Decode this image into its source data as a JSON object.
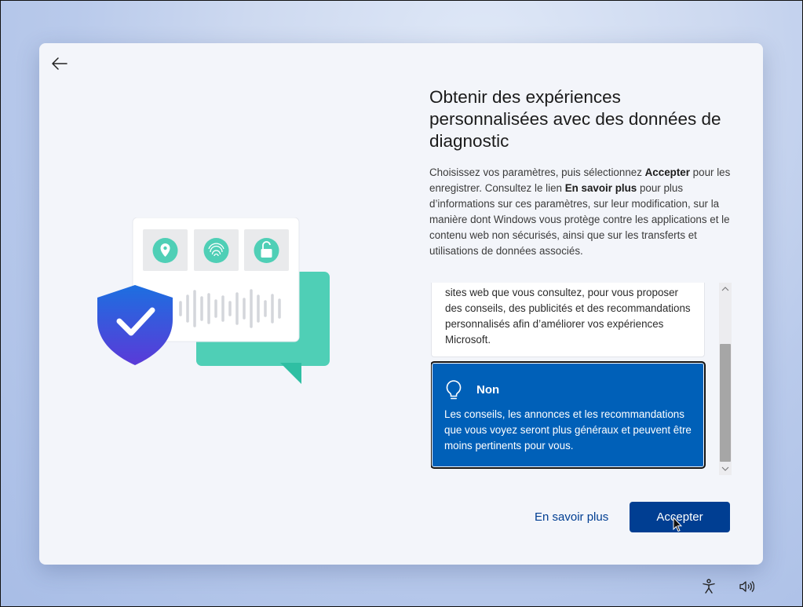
{
  "header": {
    "back_icon": "back-arrow-icon"
  },
  "title": "Obtenir des expériences personnalisées avec des données de diagnostic",
  "description": {
    "part1": "Choisissez vos paramètres, puis sélectionnez ",
    "accept_bold": "Accepter",
    "part2": " pour les enregistrer. Consultez le lien ",
    "learn_bold": "En savoir plus",
    "part3": " pour plus d’informations sur ces paramètres, sur leur modification, sur la manière dont Windows vous protège contre les applications et le contenu web non sécurisés, ainsi que sur les transferts et utilisations de données associés."
  },
  "options": {
    "yes_partial_text": "sites web que vous consultez, pour vous proposer des conseils, des publicités et des recommandations personnalisés afin d’améliorer vos expériences Microsoft.",
    "no": {
      "icon": "lightbulb-icon",
      "title": "Non",
      "description": "Les conseils, les annonces et les recommandations que vous voyez seront plus généraux et peuvent être moins pertinents pour vous.",
      "selected": true
    }
  },
  "footer": {
    "learn_more_label": "En savoir plus",
    "accept_label": "Accepter"
  },
  "tray": {
    "accessibility_icon": "accessibility-icon",
    "volume_icon": "volume-icon"
  },
  "colors": {
    "accent": "#0060b8",
    "button": "#003e92"
  }
}
